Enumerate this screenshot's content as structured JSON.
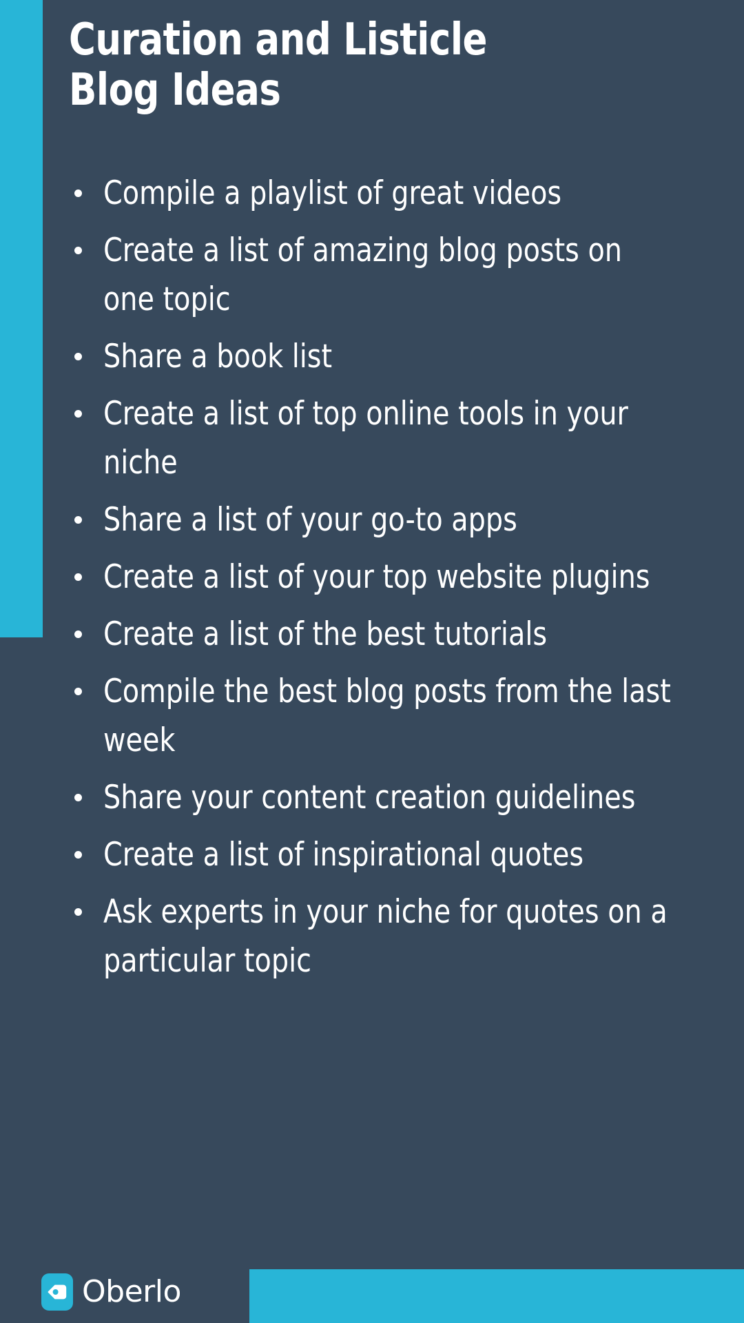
{
  "slide": {
    "background_color": "#37495c",
    "accent_color": "#28b5d7",
    "text_color": "#ffffff",
    "title": "Curation and Listicle Blog Ideas"
  },
  "ideas": [
    {
      "text": "Compile a playlist of great videos"
    },
    {
      "text": "Create a list of amazing blog posts on one topic"
    },
    {
      "text": "Share a book list"
    },
    {
      "text": "Create a list of top online tools in your niche"
    },
    {
      "text": "Share a list of your go-to apps"
    },
    {
      "text": "Create a list of your top website plugins"
    },
    {
      "text": "Create a list of the best tutorials"
    },
    {
      "text": "Compile the best blog posts from the last week"
    },
    {
      "text": "Share your content creation guidelines"
    },
    {
      "text": "Create a list of inspirational quotes"
    },
    {
      "text": "Ask experts in your niche for quotes on a particular topic"
    }
  ],
  "footer": {
    "brand_name": "Oberlo",
    "logo_icon": "oberlo-tag-icon",
    "logo_background": "#28b5d7",
    "logo_glyph_color": "#ffffff"
  }
}
